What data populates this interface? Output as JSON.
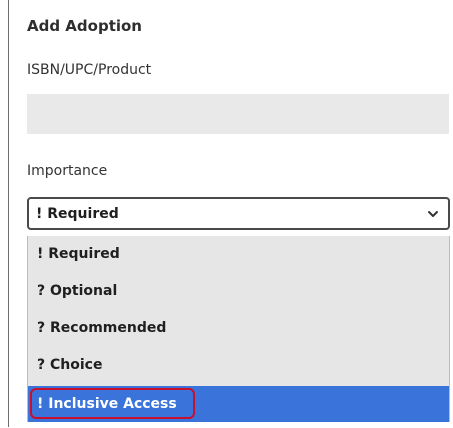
{
  "form": {
    "title": "Add Adoption",
    "isbn_label": "ISBN/UPC/Product",
    "isbn_value": "",
    "importance_label": "Importance"
  },
  "importance_select": {
    "selected": "! Required",
    "options": [
      "! Required",
      "? Optional",
      "? Recommended",
      "? Choice",
      "! Inclusive Access"
    ],
    "highlighted_index": 4,
    "highlight_color": "#3a73d9",
    "annotation_color": "#c8102e"
  }
}
